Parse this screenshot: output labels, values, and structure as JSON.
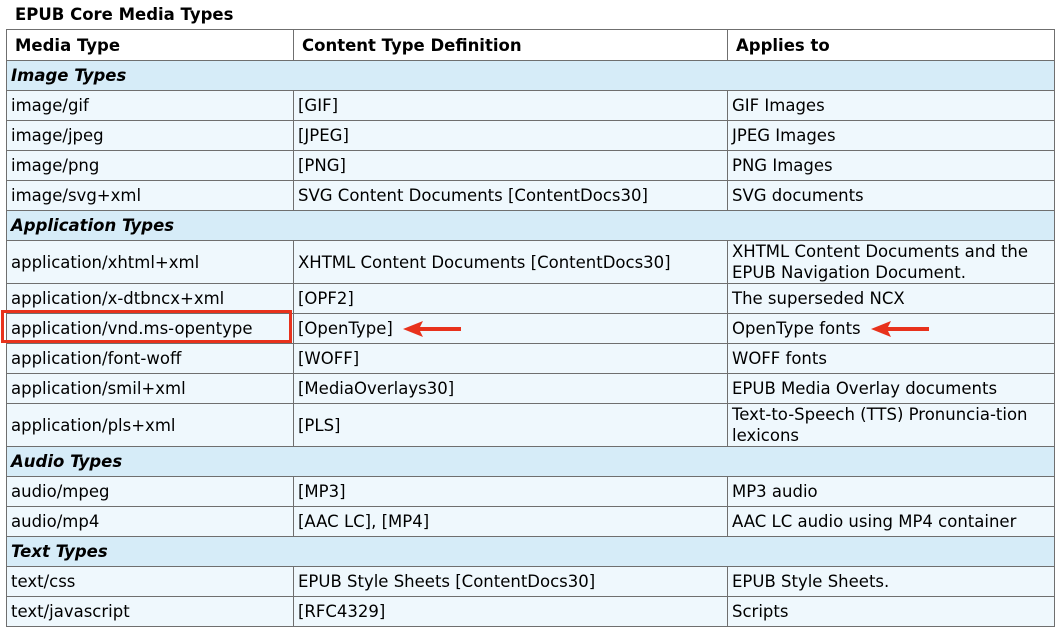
{
  "caption": "EPUB Core Media Types",
  "headers": {
    "media_type": "Media Type",
    "definition": "Content Type Definition",
    "applies_to": "Applies to"
  },
  "groups": [
    {
      "title": "Image Types",
      "rows": [
        {
          "media": "image/gif",
          "def": "[GIF]",
          "applies": "GIF Images"
        },
        {
          "media": "image/jpeg",
          "def": "[JPEG]",
          "applies": "JPEG Images"
        },
        {
          "media": "image/png",
          "def": "[PNG]",
          "applies": "PNG Images"
        },
        {
          "media": "image/svg+xml",
          "def": "SVG Content Documents [ContentDocs30]",
          "applies": "SVG documents"
        }
      ]
    },
    {
      "title": "Application Types",
      "rows": [
        {
          "media": "application/xhtml+xml",
          "def": "XHTML Content Documents [ContentDocs30]",
          "applies": "XHTML Content Documents and the EPUB Navigation Document."
        },
        {
          "media": "application/x-dtbncx+xml",
          "def": "[OPF2]",
          "applies": "The superseded NCX"
        },
        {
          "media": "application/vnd.ms-opentype",
          "def": "[OpenType]",
          "applies": "OpenType fonts"
        },
        {
          "media": "application/font-woff",
          "def": "[WOFF]",
          "applies": "WOFF fonts"
        },
        {
          "media": "application/smil+xml",
          "def": "[MediaOverlays30]",
          "applies": "EPUB Media Overlay documents"
        },
        {
          "media": "application/pls+xml",
          "def": "[PLS]",
          "applies": "Text-to-Speech (TTS) Pronuncia-tion lexicons"
        }
      ]
    },
    {
      "title": "Audio Types",
      "rows": [
        {
          "media": "audio/mpeg",
          "def": "[MP3]",
          "applies": "MP3 audio"
        },
        {
          "media": "audio/mp4",
          "def": "[AAC LC], [MP4]",
          "applies": "AAC LC audio using MP4 container"
        }
      ]
    },
    {
      "title": "Text Types",
      "rows": [
        {
          "media": "text/css",
          "def": "EPUB Style Sheets [ContentDocs30]",
          "applies": "EPUB Style Sheets."
        },
        {
          "media": "text/javascript",
          "def": "[RFC4329]",
          "applies": "Scripts"
        }
      ]
    }
  ],
  "colors": {
    "group_bg": "#d6ecf8",
    "row_bg": "#eff8fd",
    "border": "#6f6f6f",
    "annotation": "#e8321c"
  },
  "annotation_icon": "left-arrow-icon"
}
